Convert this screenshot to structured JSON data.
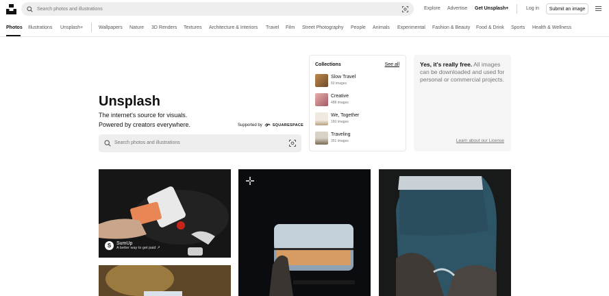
{
  "header": {
    "search_placeholder": "Search photos and illustrations",
    "nav": {
      "explore": "Explore",
      "advertise": "Advertise",
      "get_unsplash_plus": "Get Unsplash+",
      "login": "Log in",
      "submit": "Submit an image"
    }
  },
  "categories": [
    "Photos",
    "Illustrations",
    "Unsplash+",
    "Wallpapers",
    "Nature",
    "3D Renders",
    "Textures",
    "Architecture & Interiors",
    "Travel",
    "Film",
    "Street Photography",
    "People",
    "Animals",
    "Experimental",
    "Fashion & Beauty",
    "Food & Drink",
    "Sports",
    "Health & Wellness"
  ],
  "hero": {
    "title": "Unsplash",
    "subtitle_line1": "The internet's source for visuals.",
    "subtitle_line2": "Powered by creators everywhere.",
    "supported_by": "Supported by",
    "sponsor_logo": "SQUARESPACE",
    "search_placeholder": "Search photos and illustrations"
  },
  "collections": {
    "heading": "Collections",
    "see_all": "See all",
    "items": [
      {
        "name": "Slow Travel",
        "count": "50 images",
        "color": "#9b6a3a"
      },
      {
        "name": "Creative",
        "count": "488 images",
        "color": "#c97a7a"
      },
      {
        "name": "We, Together",
        "count": "160 images",
        "color": "#d9cbb3"
      },
      {
        "name": "Traveling",
        "count": "351 images",
        "color": "#8a7a63"
      }
    ]
  },
  "free_card": {
    "bold": "Yes, it's really free.",
    "rest": " All images can be downloaded and used for personal or commercial projects.",
    "link": "Learn about our License"
  },
  "photos": {
    "sponsor_name": "SumUp",
    "sponsor_tagline": "A better way to get paid ↗"
  }
}
